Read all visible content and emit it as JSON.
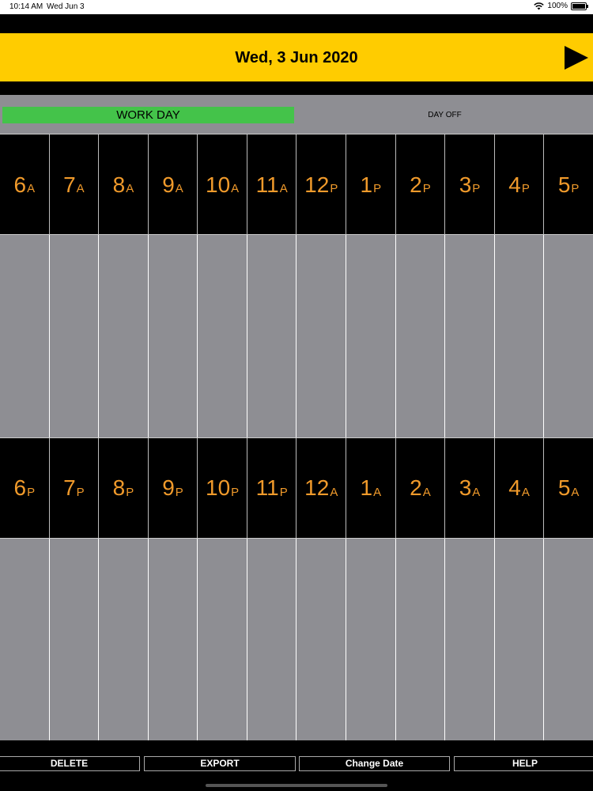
{
  "status_bar": {
    "time": "10:14 AM",
    "date": "Wed Jun 3",
    "battery": "100%"
  },
  "header": {
    "title": "Wed, 3 Jun 2020"
  },
  "day_type": {
    "work_day": "WORK DAY",
    "day_off": "DAY OFF",
    "selected": "WORK DAY",
    "selected_color": "#44c34a"
  },
  "top_hours": [
    {
      "n": "6",
      "s": "A"
    },
    {
      "n": "7",
      "s": "A"
    },
    {
      "n": "8",
      "s": "A"
    },
    {
      "n": "9",
      "s": "A"
    },
    {
      "n": "10",
      "s": "A"
    },
    {
      "n": "11",
      "s": "A"
    },
    {
      "n": "12",
      "s": "P"
    },
    {
      "n": "1",
      "s": "P"
    },
    {
      "n": "2",
      "s": "P"
    },
    {
      "n": "3",
      "s": "P"
    },
    {
      "n": "4",
      "s": "P"
    },
    {
      "n": "5",
      "s": "P"
    }
  ],
  "bottom_hours": [
    {
      "n": "6",
      "s": "P"
    },
    {
      "n": "7",
      "s": "P"
    },
    {
      "n": "8",
      "s": "P"
    },
    {
      "n": "9",
      "s": "P"
    },
    {
      "n": "10",
      "s": "P"
    },
    {
      "n": "11",
      "s": "P"
    },
    {
      "n": "12",
      "s": "A"
    },
    {
      "n": "1",
      "s": "A"
    },
    {
      "n": "2",
      "s": "A"
    },
    {
      "n": "3",
      "s": "A"
    },
    {
      "n": "4",
      "s": "A"
    },
    {
      "n": "5",
      "s": "A"
    }
  ],
  "toolbar": {
    "delete": "DELETE",
    "export": "EXPORT",
    "change_date": "Change Date",
    "help": "HELP"
  },
  "colors": {
    "header": "#ffcc00",
    "hour_text": "#f09a2b",
    "slot_gray": "#8e8e93"
  },
  "icons": {
    "next": "play-triangle-icon",
    "wifi": "wifi-icon",
    "battery": "battery-icon"
  }
}
